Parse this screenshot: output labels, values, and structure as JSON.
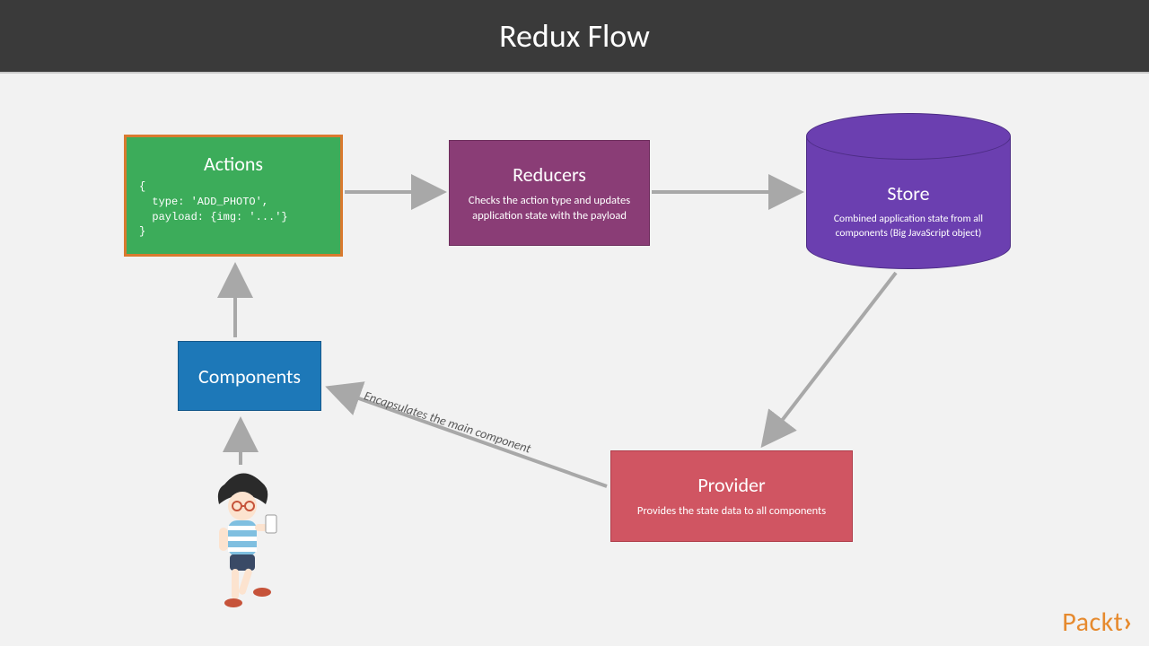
{
  "header": {
    "title": "Redux Flow"
  },
  "actions": {
    "title": "Actions",
    "code": "{\n  type: 'ADD_PHOTO',\n  payload: {img: '...'}\n}"
  },
  "reducers": {
    "title": "Reducers",
    "desc": "Checks the action type and updates application state with the payload"
  },
  "store": {
    "title": "Store",
    "desc": "Combined application state from all components\n(Big JavaScript object)"
  },
  "components": {
    "title": "Components"
  },
  "provider": {
    "title": "Provider",
    "desc": "Provides the state data to all components"
  },
  "edge_label": "Encapsulates the main component",
  "brand": "Packt",
  "colors": {
    "actions": "#3cac5a",
    "actions_border": "#d97a2f",
    "reducers": "#8a3d76",
    "store": "#6b3fb0",
    "components": "#1d78b8",
    "provider": "#d05562",
    "arrow": "#a8a8a8",
    "header": "#3a3a3a"
  }
}
